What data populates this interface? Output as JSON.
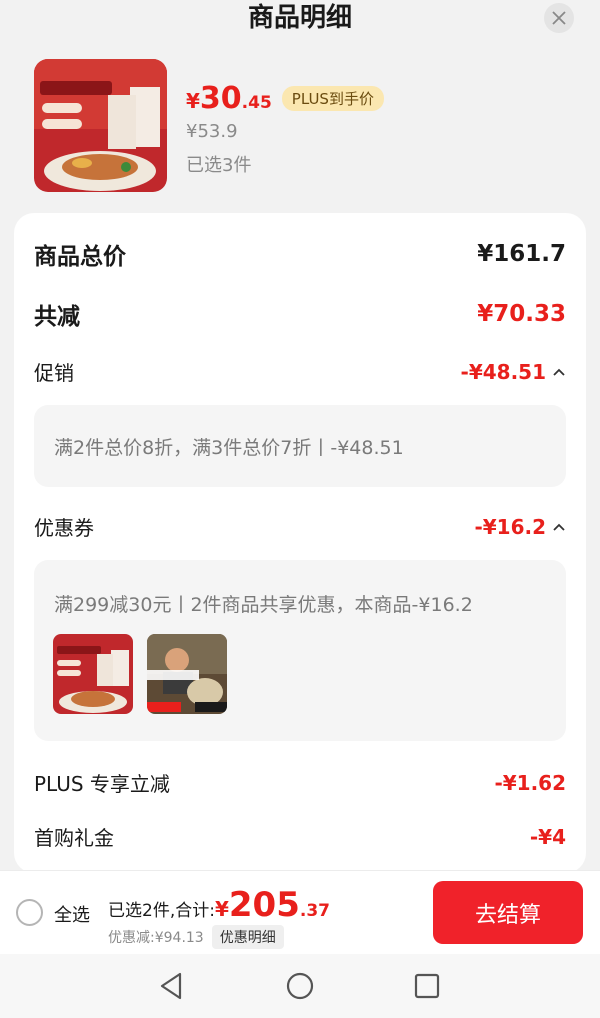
{
  "header": {
    "title": "商品明细",
    "close_icon": "close-icon"
  },
  "product": {
    "price_symbol": "¥",
    "price_int": "30",
    "price_dec": ".45",
    "plus_badge": "PLUS到手价",
    "original_price": "¥53.9",
    "selected_count": "已选3件"
  },
  "summary": {
    "total_label": "商品总价",
    "total_value": "¥161.7",
    "reduce_label": "共减",
    "reduce_value": "¥70.33",
    "promo_label": "促销",
    "promo_value": "-¥48.51",
    "promo_detail": "满2件总价8折，满3件总价7折丨-¥48.51",
    "coupon_label": "优惠券",
    "coupon_value": "-¥16.2",
    "coupon_detail": "满299减30元丨2件商品共享优惠，本商品-¥16.2",
    "plus_label": "PLUS 专享立减",
    "plus_value": "-¥1.62",
    "first_label": "首购礼金",
    "first_value": "-¥4"
  },
  "bottom": {
    "select_all": "全选",
    "total_prefix": "已选2件,合计:",
    "total_symbol": "¥",
    "total_int": "205",
    "total_dec": ".37",
    "discount_text": "优惠减:¥94.13",
    "detail_button": "优惠明细",
    "checkout_button": "去结算"
  },
  "colors": {
    "accent": "#e8201c",
    "checkout": "#f0222a",
    "plus_badge_bg": "#fbe7b0"
  },
  "nav": {
    "back_icon": "back-triangle-icon",
    "home_icon": "home-circle-icon",
    "recents_icon": "recents-square-icon"
  }
}
